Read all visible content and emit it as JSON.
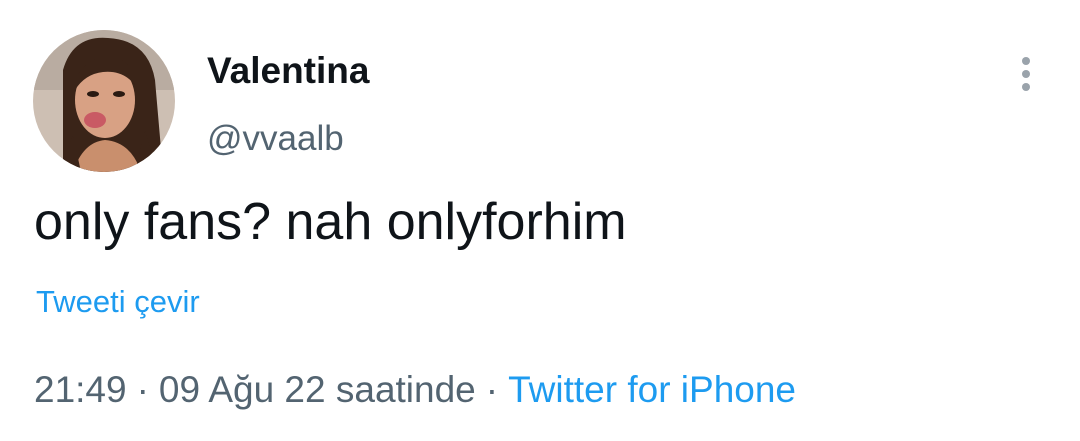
{
  "tweet": {
    "author": {
      "display_name": "Valentina",
      "handle": "@vvaalb",
      "avatar_icon": "profile-photo"
    },
    "more_icon": "more-vertical-icon",
    "text": "only fans? nah onlyforhim",
    "translate_label": "Tweeti çevir",
    "meta": {
      "time": "21:49",
      "separator": "·",
      "date": "09 Ağu 22 saatinde",
      "source": "Twitter for iPhone"
    }
  },
  "colors": {
    "text_primary": "#0f1419",
    "text_secondary": "#536471",
    "link": "#1d9bf0",
    "background": "#ffffff"
  }
}
